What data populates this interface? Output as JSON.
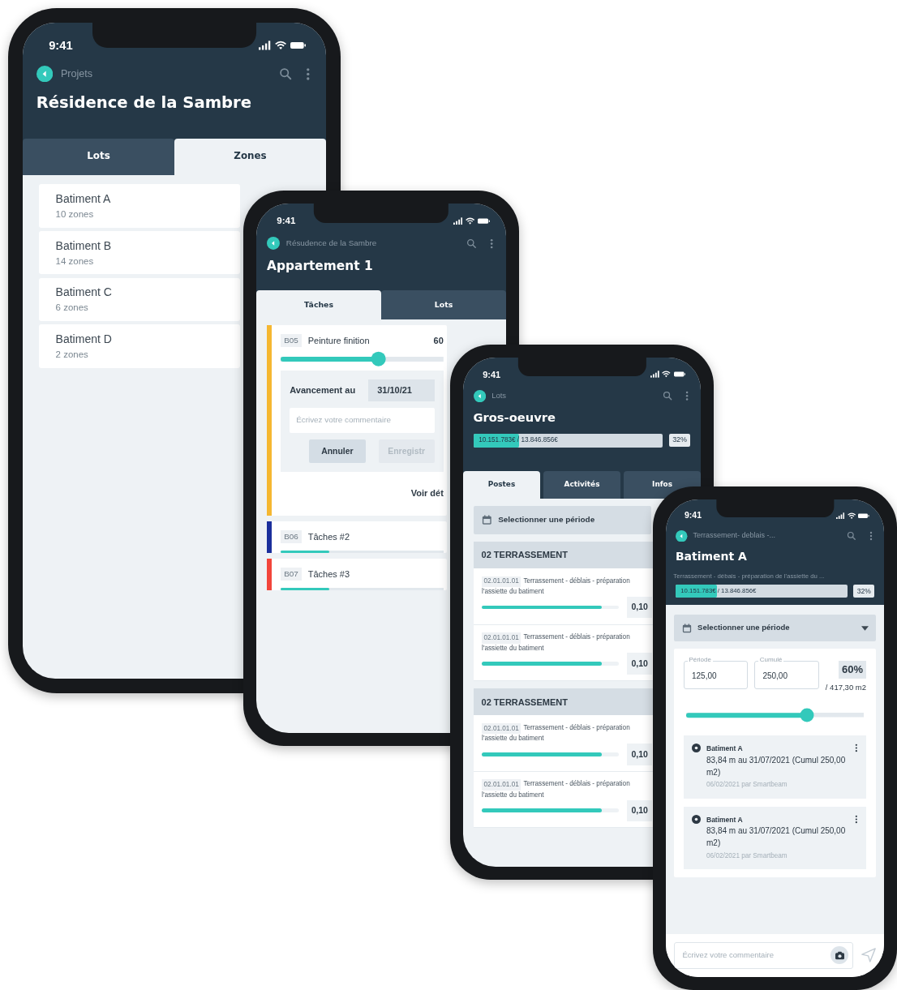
{
  "phones": [
    {
      "kind": "zones",
      "time": "9:41",
      "back_label": "Projets",
      "title": "Résidence de la Sambre",
      "tabs": [
        {
          "label": "Lots",
          "selected": false
        },
        {
          "label": "Zones",
          "selected": true
        }
      ],
      "items": [
        {
          "title": "Batiment A",
          "subtitle": "10 zones"
        },
        {
          "title": "Batiment B",
          "subtitle": "14 zones"
        },
        {
          "title": "Batiment C",
          "subtitle": "6 zones"
        },
        {
          "title": "Batiment D",
          "subtitle": "2 zones"
        }
      ]
    },
    {
      "kind": "tasks",
      "time": "9:41",
      "back_label": "Résudence de la Sambre",
      "title": "Appartement 1",
      "tabs": [
        {
          "label": "Tâches",
          "selected": true
        },
        {
          "label": "Lots",
          "selected": false
        }
      ],
      "tasks": [
        {
          "code": "B05",
          "name": "Peinture finition",
          "percent": "60",
          "color": "#f5b731",
          "expanded": true,
          "level": 0.6,
          "progress_label": "Avancement au",
          "date": "31/10/21",
          "comment_placeholder": "Écrivez votre commentaire",
          "buttons": [
            {
              "label": "Annuler",
              "disabled": false
            },
            {
              "label": "Enregistr",
              "disabled": true
            }
          ],
          "details_link": "Voir dét"
        },
        {
          "code": "B06",
          "name": "Tâches #2",
          "color": "#1b2f9c",
          "expanded": false,
          "level": 0.3
        },
        {
          "code": "B07",
          "name": "Tâches #3",
          "color": "#f2453b",
          "expanded": false,
          "level": 0.3
        }
      ]
    },
    {
      "kind": "posts",
      "time": "9:41",
      "back_label": "Lots",
      "title": "Gros-oeuvre",
      "budget": {
        "text": "10.151.783€ / 13.846.856€",
        "level": 0.24,
        "percent": "32%"
      },
      "tabs": [
        {
          "label": "Postes",
          "selected": true
        },
        {
          "label": "Activités",
          "selected": false
        },
        {
          "label": "Infos",
          "selected": false
        }
      ],
      "period_label": "Selectionner une période",
      "sections": [
        {
          "title": "02 TERRASSEMENT",
          "items": [
            {
              "code": "02.01.01.01",
              "lines": [
                "Terrassement - déblais - préparation",
                "l'assiette du batiment"
              ],
              "level": 0.88,
              "value": "0,10"
            },
            {
              "code": "02.01.01.01",
              "lines": [
                "Terrassement - déblais - préparation",
                "l'assiette du batiment"
              ],
              "level": 0.88,
              "value": "0,10"
            }
          ]
        },
        {
          "title": "02 TERRASSEMENT",
          "items": [
            {
              "code": "02.01.01.01",
              "lines": [
                "Terrassement - déblais - préparation",
                "l'assiette du batiment"
              ],
              "level": 0.88,
              "value": "0,10"
            },
            {
              "code": "02.01.01.01",
              "lines": [
                "Terrassement - déblais - préparation",
                "l'assiette du batiment"
              ],
              "level": 0.88,
              "value": "0,10"
            }
          ]
        }
      ]
    },
    {
      "kind": "detail",
      "time": "9:41",
      "back_label": "Terrassement- deblais -...",
      "title": "Batiment A",
      "subtitle": "Terrassement - débais - préparation de l'assiette du ...",
      "budget": {
        "text": "10.151.783€ / 13.846.856€",
        "level": 0.24,
        "percent": "32%"
      },
      "period_label": "Selectionner une période",
      "fields": [
        {
          "label": "Période",
          "value": "125,00"
        },
        {
          "label": "Cumulé",
          "value": "250,00"
        }
      ],
      "percent": "60%",
      "total": "/ 417,30 m2",
      "level": 0.68,
      "entries": [
        {
          "title": "Batiment A",
          "text": "83,84 m au 31/07/2021 (Cumul 250,00 m2)",
          "meta": "06/02/2021 par Smartbeam"
        },
        {
          "title": "Batiment A",
          "text": "83,84 m au 31/07/2021 (Cumul 250,00 m2)",
          "meta": "06/02/2021 par Smartbeam"
        }
      ],
      "comment_placeholder": "Écrivez votre commentaire"
    }
  ]
}
